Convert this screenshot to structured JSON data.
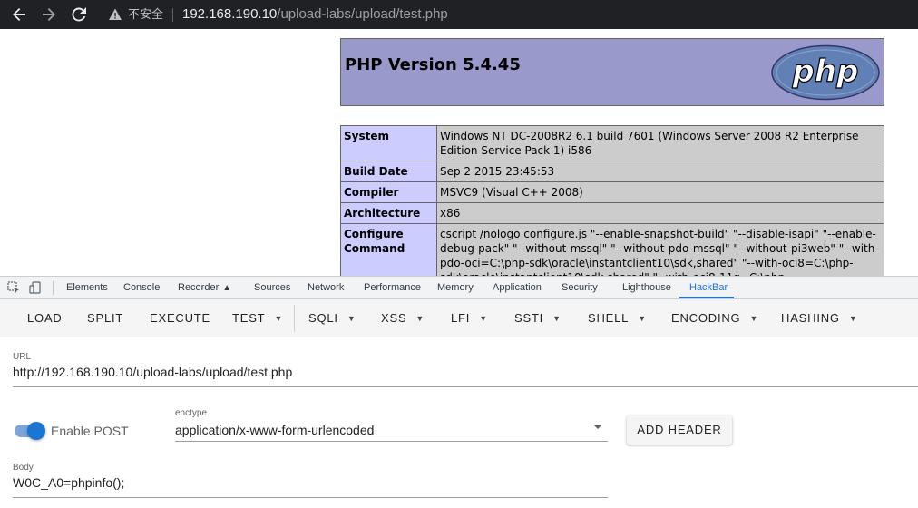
{
  "browser": {
    "insecure_label": "不安全",
    "url_host": "192.168.190.10",
    "url_path": "/upload-labs/upload/test.php",
    "icons": [
      "back-arrow-icon",
      "forward-arrow-icon",
      "reload-icon",
      "warning-icon"
    ]
  },
  "phpinfo": {
    "title": "PHP Version 5.4.45",
    "logo_text": "php",
    "rows": [
      {
        "key": "System",
        "value": "Windows NT DC-2008R2 6.1 build 7601 (Windows Server 2008 R2 Enterprise Edition Service Pack 1) i586"
      },
      {
        "key": "Build Date",
        "value": "Sep 2 2015 23:45:53"
      },
      {
        "key": "Compiler",
        "value": "MSVC9 (Visual C++ 2008)"
      },
      {
        "key": "Architecture",
        "value": "x86"
      },
      {
        "key": "Configure Command",
        "value": "cscript /nologo configure.js \"--enable-snapshot-build\" \"--disable-isapi\" \"--enable-debug-pack\" \"--without-mssql\" \"--without-pdo-mssql\" \"--without-pi3web\" \"--with-pdo-oci=C:\\php-sdk\\oracle\\instantclient10\\sdk,shared\" \"--with-oci8=C:\\php-sdk\\oracle\\instantclient10\\sdk,shared\" \"--with-oci8-11g=C:\\php-"
      }
    ]
  },
  "devtools": {
    "tabs": [
      "Elements",
      "Console",
      "Recorder",
      "Sources",
      "Network",
      "Performance",
      "Memory",
      "Application",
      "Security",
      "Lighthouse",
      "HackBar"
    ],
    "active_tab": "HackBar",
    "accent_color": "#1a73e8"
  },
  "hackbar": {
    "toolbar": {
      "load": "LOAD",
      "split": "SPLIT",
      "execute": "EXECUTE",
      "test": "TEST",
      "sqli": "SQLI",
      "xss": "XSS",
      "lfi": "LFI",
      "ssti": "SSTI",
      "shell": "SHELL",
      "encoding": "ENCODING",
      "hashing": "HASHING"
    },
    "url_label": "URL",
    "url_value": "http://192.168.190.10/upload-labs/upload/test.php",
    "enable_post_label": "Enable POST",
    "enable_post_on": true,
    "enctype_label": "enctype",
    "enctype_value": "application/x-www-form-urlencoded",
    "add_header_label": "ADD HEADER",
    "body_label": "Body",
    "body_value": "W0C_A0=phpinfo();"
  }
}
